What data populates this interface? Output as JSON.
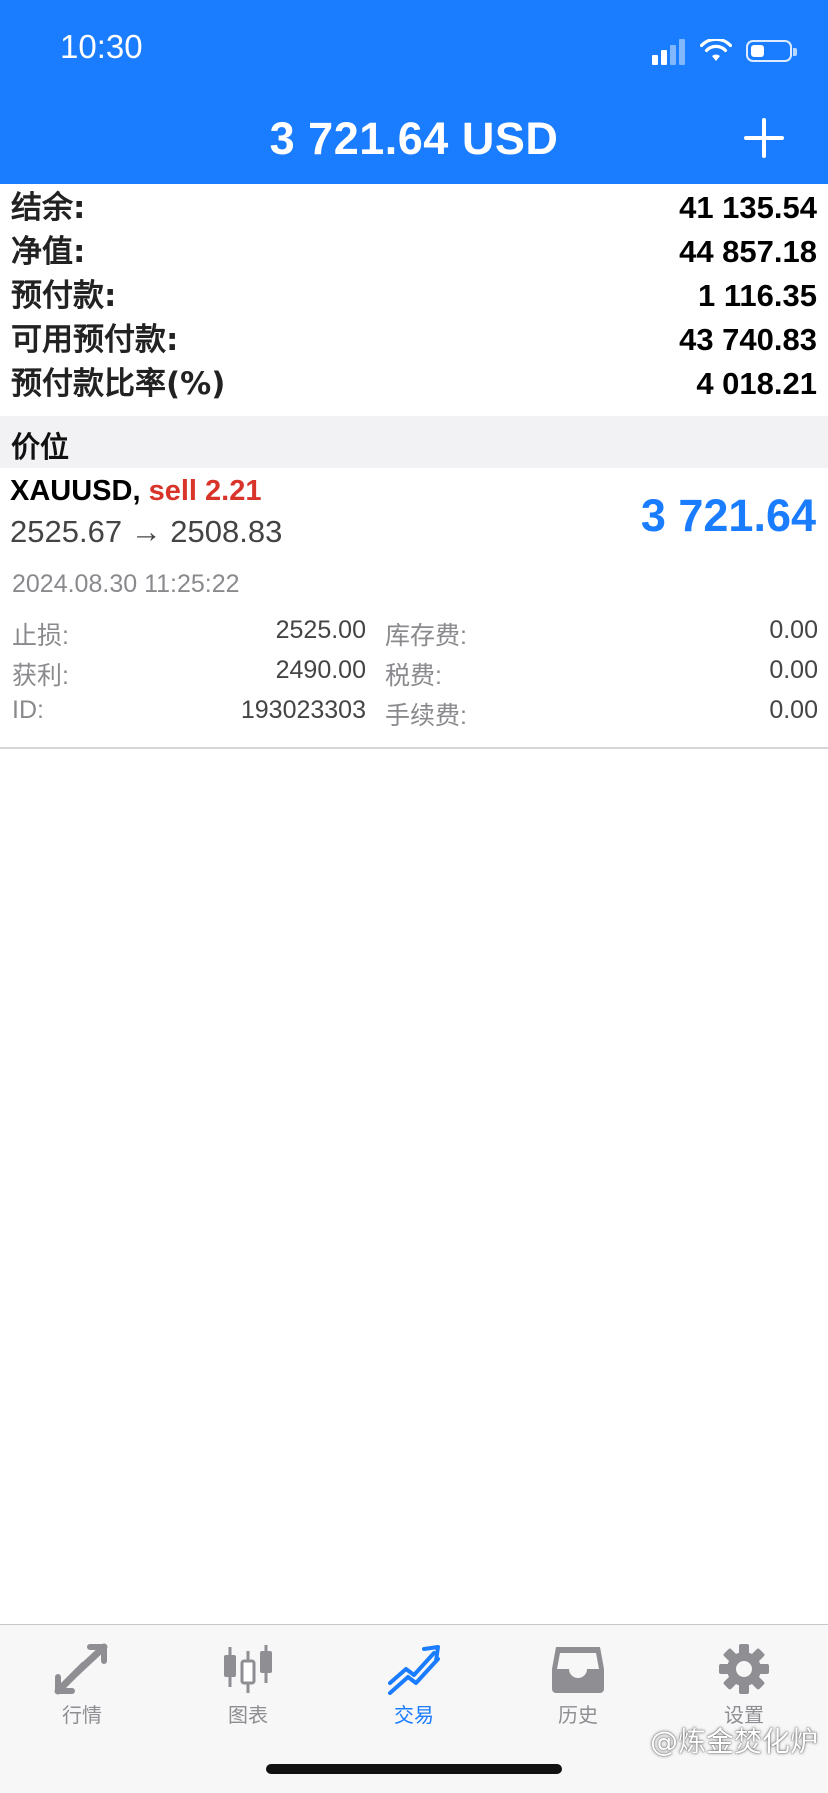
{
  "status_bar": {
    "time": "10:30"
  },
  "header": {
    "title": "3 721.64 USD"
  },
  "account": [
    {
      "label": "结余:",
      "value": "41 135.54"
    },
    {
      "label": "净值:",
      "value": "44 857.18"
    },
    {
      "label": "预付款:",
      "value": "1 116.35"
    },
    {
      "label": "可用预付款:",
      "value": "43 740.83"
    },
    {
      "label": "预付款比率(%)",
      "value": "4 018.21"
    }
  ],
  "section": {
    "title": "价位"
  },
  "position": {
    "symbol": "XAUUSD,",
    "side": "sell 2.21",
    "prices": "2525.67 → 2508.83",
    "profit": "3 721.64",
    "time": "2024.08.30 11:25:22",
    "details_left": [
      {
        "label": "止损:",
        "value": "2525.00"
      },
      {
        "label": "获利:",
        "value": "2490.00"
      },
      {
        "label": "ID:",
        "value": "193023303"
      }
    ],
    "details_right": [
      {
        "label": "库存费:",
        "value": "0.00"
      },
      {
        "label": "税费:",
        "value": "0.00"
      },
      {
        "label": "手续费:",
        "value": "0.00"
      }
    ]
  },
  "tabbar": {
    "items": [
      {
        "label": "行情",
        "icon": "quotes-arrows-icon",
        "active": false
      },
      {
        "label": "图表",
        "icon": "candlestick-chart-icon",
        "active": false
      },
      {
        "label": "交易",
        "icon": "trade-trend-icon",
        "active": true
      },
      {
        "label": "历史",
        "icon": "history-inbox-icon",
        "active": false
      },
      {
        "label": "设置",
        "icon": "gear-icon",
        "active": false
      }
    ]
  },
  "watermark": "@炼金焚化炉",
  "colors": {
    "header": "#1a7cff",
    "accent": "#1a7cff",
    "sell": "#d8342a"
  }
}
